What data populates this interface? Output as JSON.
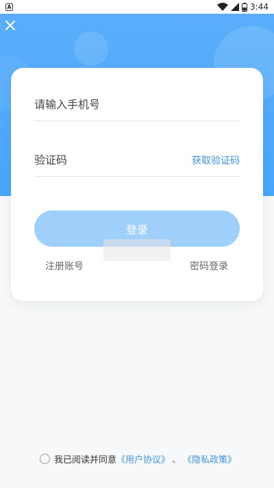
{
  "status_bar": {
    "notification_glyph": "A",
    "time": "3:44",
    "icons": [
      "wifi-icon",
      "signal-icon",
      "battery-icon"
    ]
  },
  "colors": {
    "header_blue": "#4aa6fb",
    "login_button": "#9fcffb",
    "link_blue": "#3d93e8"
  },
  "form": {
    "phone_placeholder": "请输入手机号",
    "code_placeholder": "验证码",
    "get_code_label": "获取验证码",
    "login_label": "登录",
    "register_label": "注册账号",
    "password_login_label": "密码登录"
  },
  "agreement": {
    "prefix": "我已阅读并同意",
    "user_agreement": "《用户协议》",
    "separator": "、",
    "privacy_policy": "《隐私政策》"
  }
}
